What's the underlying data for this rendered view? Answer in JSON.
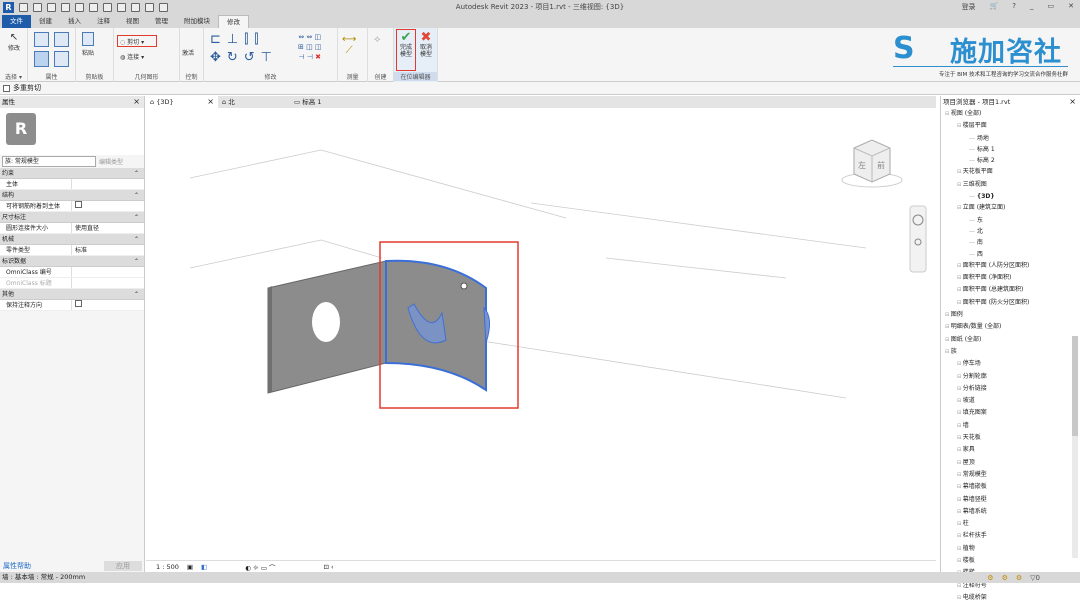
{
  "app": {
    "title": "Autodesk Revit 2023 - 项目1.rvt - 三维视图: {3D}",
    "logo_letter": "R",
    "user": "登录",
    "help": "?",
    "window_controls": [
      "_",
      "▭",
      "✕"
    ]
  },
  "tabs": [
    "文件",
    "创建",
    "插入",
    "注释",
    "视图",
    "管理",
    "附加模块",
    "修改"
  ],
  "ribbon": {
    "panels": [
      "选择 ▾",
      "属性",
      "剪贴板",
      "几何图形",
      "控制",
      "修改",
      "测量",
      "创建",
      "在位编辑器"
    ],
    "buttons": {
      "modify": "修改",
      "paste": "粘贴",
      "cut": "剪切",
      "join": "连接",
      "activate": "激活",
      "finish": "完成\n模型",
      "finish1": "完成",
      "finish2": "模型",
      "cancel1": "取消",
      "cancel2": "模型"
    }
  },
  "logo": {
    "mark": "S",
    "name": "施加咨社",
    "tagline": "专注于 BIM 技术和工程咨询的学习交流合作服务社群"
  },
  "options_bar": {
    "multi_cut": "多重剪切"
  },
  "properties": {
    "title": "属性",
    "family": "族: 常规模型",
    "edit_type": "编辑类型",
    "sections": [
      {
        "name": "约束",
        "rows": [
          {
            "k": "主体",
            "v": ""
          }
        ]
      },
      {
        "name": "结构",
        "rows": [
          {
            "k": "可将钢筋附着到主体",
            "v": "checkbox"
          }
        ]
      },
      {
        "name": "尺寸标注",
        "rows": [
          {
            "k": "圆形连接件大小",
            "v": "使用直径"
          }
        ]
      },
      {
        "name": "机械",
        "rows": [
          {
            "k": "零件类型",
            "v": "标准"
          }
        ]
      },
      {
        "name": "标识数据",
        "rows": [
          {
            "k": "OmniClass 编号",
            "v": ""
          },
          {
            "k": "OmniClass 标题",
            "v": ""
          }
        ]
      },
      {
        "name": "其他",
        "rows": [
          {
            "k": "保持注释方向",
            "v": "checkbox"
          }
        ]
      }
    ],
    "help_link": "属性帮助",
    "apply": "应用"
  },
  "view_tabs": [
    "{3D}",
    "北",
    "标高 1"
  ],
  "view_scale": "1 : 500",
  "viewcube": {
    "left": "左",
    "front": "前"
  },
  "browser": {
    "title": "项目浏览器 - 项目1.rvt",
    "items": [
      {
        "t": "视图 (全部)",
        "lvl": 0
      },
      {
        "t": "楼层平面",
        "lvl": 1
      },
      {
        "t": "场地",
        "lvl": 2
      },
      {
        "t": "标高 1",
        "lvl": 2
      },
      {
        "t": "标高 2",
        "lvl": 2
      },
      {
        "t": "天花板平面",
        "lvl": 1
      },
      {
        "t": "三维视图",
        "lvl": 1
      },
      {
        "t": "{3D}",
        "lvl": 2
      },
      {
        "t": "立面 (建筑立面)",
        "lvl": 1
      },
      {
        "t": "东",
        "lvl": 2
      },
      {
        "t": "北",
        "lvl": 2
      },
      {
        "t": "南",
        "lvl": 2
      },
      {
        "t": "西",
        "lvl": 2
      },
      {
        "t": "面积平面 (人防分区面积)",
        "lvl": 1
      },
      {
        "t": "面积平面 (净面积)",
        "lvl": 1
      },
      {
        "t": "面积平面 (总建筑面积)",
        "lvl": 1
      },
      {
        "t": "面积平面 (防火分区面积)",
        "lvl": 1
      },
      {
        "t": "图例",
        "lvl": 0
      },
      {
        "t": "明细表/数量 (全部)",
        "lvl": 0
      },
      {
        "t": "图纸 (全部)",
        "lvl": 0
      },
      {
        "t": "族",
        "lvl": 0
      },
      {
        "t": "停车场",
        "lvl": 1
      },
      {
        "t": "分割轮廓",
        "lvl": 1
      },
      {
        "t": "分析链接",
        "lvl": 1
      },
      {
        "t": "坡道",
        "lvl": 1
      },
      {
        "t": "填充图案",
        "lvl": 1
      },
      {
        "t": "墙",
        "lvl": 1
      },
      {
        "t": "天花板",
        "lvl": 1
      },
      {
        "t": "家具",
        "lvl": 1
      },
      {
        "t": "屋顶",
        "lvl": 1
      },
      {
        "t": "常规模型",
        "lvl": 1
      },
      {
        "t": "幕墙嵌板",
        "lvl": 1
      },
      {
        "t": "幕墙竖梃",
        "lvl": 1
      },
      {
        "t": "幕墙系统",
        "lvl": 1
      },
      {
        "t": "柱",
        "lvl": 1
      },
      {
        "t": "栏杆扶手",
        "lvl": 1
      },
      {
        "t": "植物",
        "lvl": 1
      },
      {
        "t": "楼板",
        "lvl": 1
      },
      {
        "t": "楼梯",
        "lvl": 1
      },
      {
        "t": "注释符号",
        "lvl": 1
      },
      {
        "t": "电缆桥架",
        "lvl": 1
      }
    ]
  },
  "status": {
    "text": "墙 : 基本墙 : 常规 - 200mm",
    "filter": "0"
  },
  "colors": {
    "accent": "#1e5ba8",
    "highlight": "#e23b2e",
    "selection": "#3a6fd8"
  }
}
